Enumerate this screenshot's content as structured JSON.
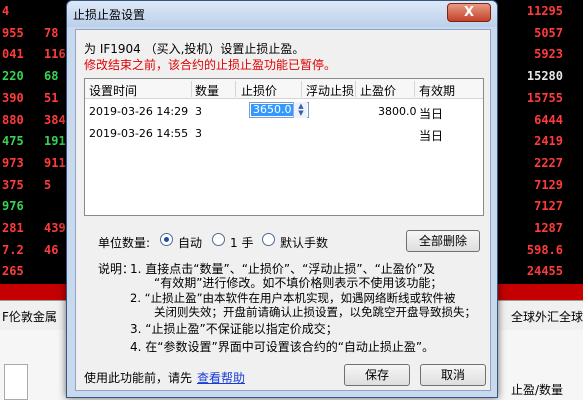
{
  "background": {
    "left_rows": [
      {
        "c1": "4",
        "c2": "",
        "color": "red"
      },
      {
        "c1": "955",
        "c2": "78",
        "color": "red"
      },
      {
        "c1": "041",
        "c2": "116",
        "color": "red"
      },
      {
        "c1": "220",
        "c2": "68",
        "color": "green"
      },
      {
        "c1": "390",
        "c2": "51",
        "color": "red"
      },
      {
        "c1": "880",
        "c2": "384",
        "color": "red"
      },
      {
        "c1": "475",
        "c2": "191",
        "color": "green"
      },
      {
        "c1": "973",
        "c2": "911",
        "color": "red"
      },
      {
        "c1": "375",
        "c2": "5",
        "color": "red"
      },
      {
        "c1": "976",
        "c2": "",
        "color": "green"
      },
      {
        "c1": "281",
        "c2": "439",
        "color": "red"
      },
      {
        "c1": "7.2",
        "c2": "46",
        "color": "red"
      },
      {
        "c1": "265",
        "c2": "",
        "color": "red"
      },
      {
        "c1": "4.2",
        "c2": "",
        "color": "green"
      }
    ],
    "right_values": [
      {
        "v": "11295",
        "color": "red"
      },
      {
        "v": "5057",
        "color": "red"
      },
      {
        "v": "5923",
        "color": "red"
      },
      {
        "v": "15280",
        "color": "white"
      },
      {
        "v": "15755",
        "color": "red"
      },
      {
        "v": "6444",
        "color": "red"
      },
      {
        "v": "2419",
        "color": "red"
      },
      {
        "v": "2227",
        "color": "red"
      },
      {
        "v": "7129",
        "color": "red"
      },
      {
        "v": "7127",
        "color": "red"
      },
      {
        "v": "1287",
        "color": "red"
      },
      {
        "v": "598.6",
        "color": "red"
      },
      {
        "v": "24455",
        "color": "red"
      },
      {
        "v": "3769.4",
        "color": "yellow"
      }
    ],
    "strip_left": "F伦敦金属",
    "strip_right_1": "全球外汇",
    "strip_right_2": "全球",
    "lower_col": "止盈/数量"
  },
  "dialog": {
    "title": "止损止盈设置",
    "close_label": "X",
    "desc_line": "为 IF1904 （买入,投机）设置止损止盈。",
    "warning_line": "修改结束之前，该合约的止损止盈功能已暂停。",
    "columns": [
      "设置时间",
      "数量",
      "止损价",
      "浮动止损",
      "止盈价",
      "有效期"
    ],
    "rows": [
      {
        "time": "2019-03-26 14:29",
        "qty": "3",
        "stop_loss": "3650.0",
        "float_stop": "",
        "take_profit": "3800.0",
        "validity": "当日"
      },
      {
        "time": "2019-03-26 14:55",
        "qty": "3",
        "stop_loss": "",
        "float_stop": "",
        "take_profit": "",
        "validity": "当日"
      }
    ],
    "unit_label": "单位数量:",
    "unit_options": [
      {
        "label": "自动",
        "selected": true
      },
      {
        "label": "1 手",
        "selected": false
      },
      {
        "label": "默认手数",
        "selected": false
      }
    ],
    "delete_all_label": "全部删除",
    "notes_title": "说明：",
    "notes": [
      "1.  直接点击“数量”、“止损价”、“浮动止损”、“止盈价”及",
      "“有效期”进行修改。如不填价格则表示不使用该功能；",
      "2.  “止损止盈”由本软件在用户本机实现，如遇网络断线或软件被",
      "关闭则失效；开盘前请确认止损设置，以免跳空开盘导致损失；",
      "3.  “止损止盈”不保证能以指定价成交；",
      "4.  在“参数设置”界面中可设置该合约的“自动止损止盈”。"
    ],
    "help_prefix": "使用此功能前，请先",
    "help_link": "查看帮助",
    "save_label": "保存",
    "cancel_label": "取消",
    "colors": {
      "warning": "#e00000",
      "highlight_box": "#e0001a",
      "link": "#1a3cd6"
    }
  }
}
